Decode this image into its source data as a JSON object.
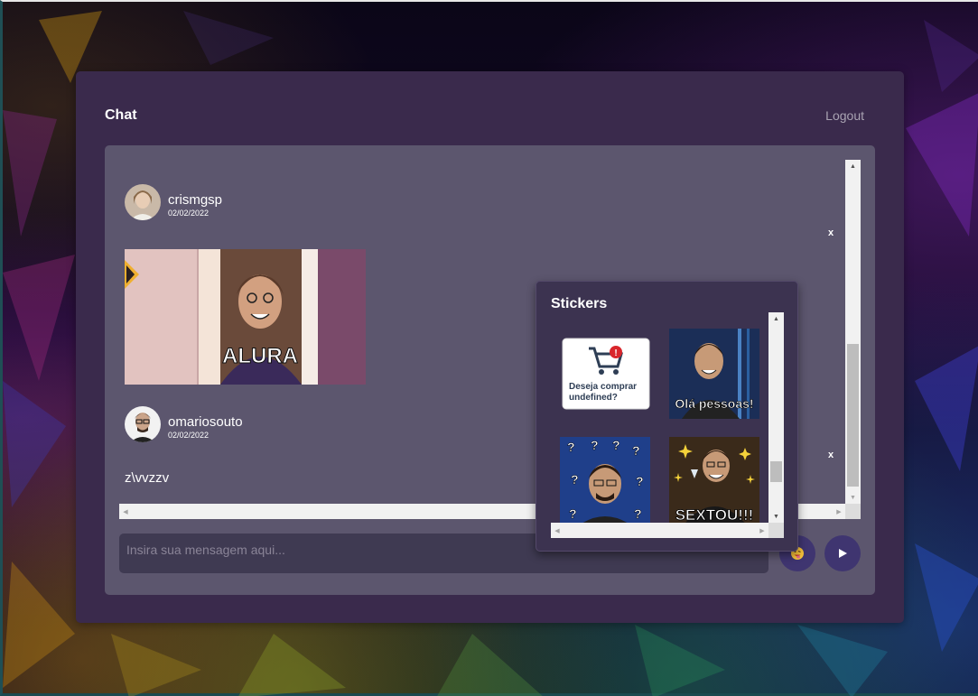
{
  "header": {
    "title": "Chat",
    "logout_label": "Logout"
  },
  "messages": [
    {
      "username": "crismgsp",
      "date": "02/02/2022",
      "avatar_icon": "avatar-woman",
      "type": "sticker",
      "sticker_caption": "ALURA",
      "delete_label": "x"
    },
    {
      "username": "omariosouto",
      "date": "02/02/2022",
      "avatar_icon": "avatar-man-glasses",
      "type": "text",
      "text": "z\\vvzzv",
      "delete_label": "x"
    }
  ],
  "composer": {
    "placeholder": "Insira sua mensagem aqui...",
    "sticker_button_icon": "sticker-emoji-icon",
    "send_button_icon": "play-icon"
  },
  "sticker_panel": {
    "title": "Stickers",
    "stickers": [
      {
        "name": "cart-sticker",
        "line1": "Deseja comprar",
        "line2": "undefined?"
      },
      {
        "name": "ola-pessoas-sticker",
        "caption": "Olá pessoas!"
      },
      {
        "name": "confused-sticker",
        "caption": ""
      },
      {
        "name": "sextou-sticker",
        "caption": "SEXTOU!!!"
      }
    ]
  },
  "colors": {
    "panel": "#3a2a4c",
    "chat_bg": "#5c566e",
    "button": "#3f3570",
    "input": "#3f3a52"
  }
}
